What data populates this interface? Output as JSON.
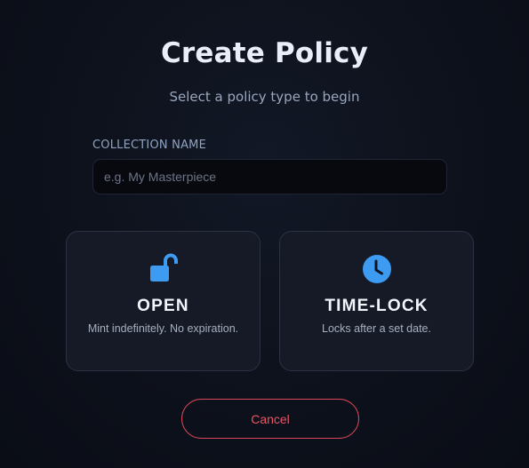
{
  "header": {
    "title": "Create Policy",
    "subtitle": "Select a policy type to begin"
  },
  "collection": {
    "label": "COLLECTION NAME",
    "placeholder": "e.g. My Masterpiece",
    "value": ""
  },
  "policy_types": [
    {
      "title": "OPEN",
      "description": "Mint indefinitely. No expiration.",
      "icon": "unlocked-padlock-icon"
    },
    {
      "title": "TIME-LOCK",
      "description": "Locks after a set date.",
      "icon": "clock-icon"
    }
  ],
  "actions": {
    "cancel_label": "Cancel"
  },
  "colors": {
    "background": "#0d111b",
    "card_background": "#151a26",
    "card_border": "#2b3244",
    "icon_accent": "#3d9bf2",
    "cancel_accent": "#ec5566"
  }
}
